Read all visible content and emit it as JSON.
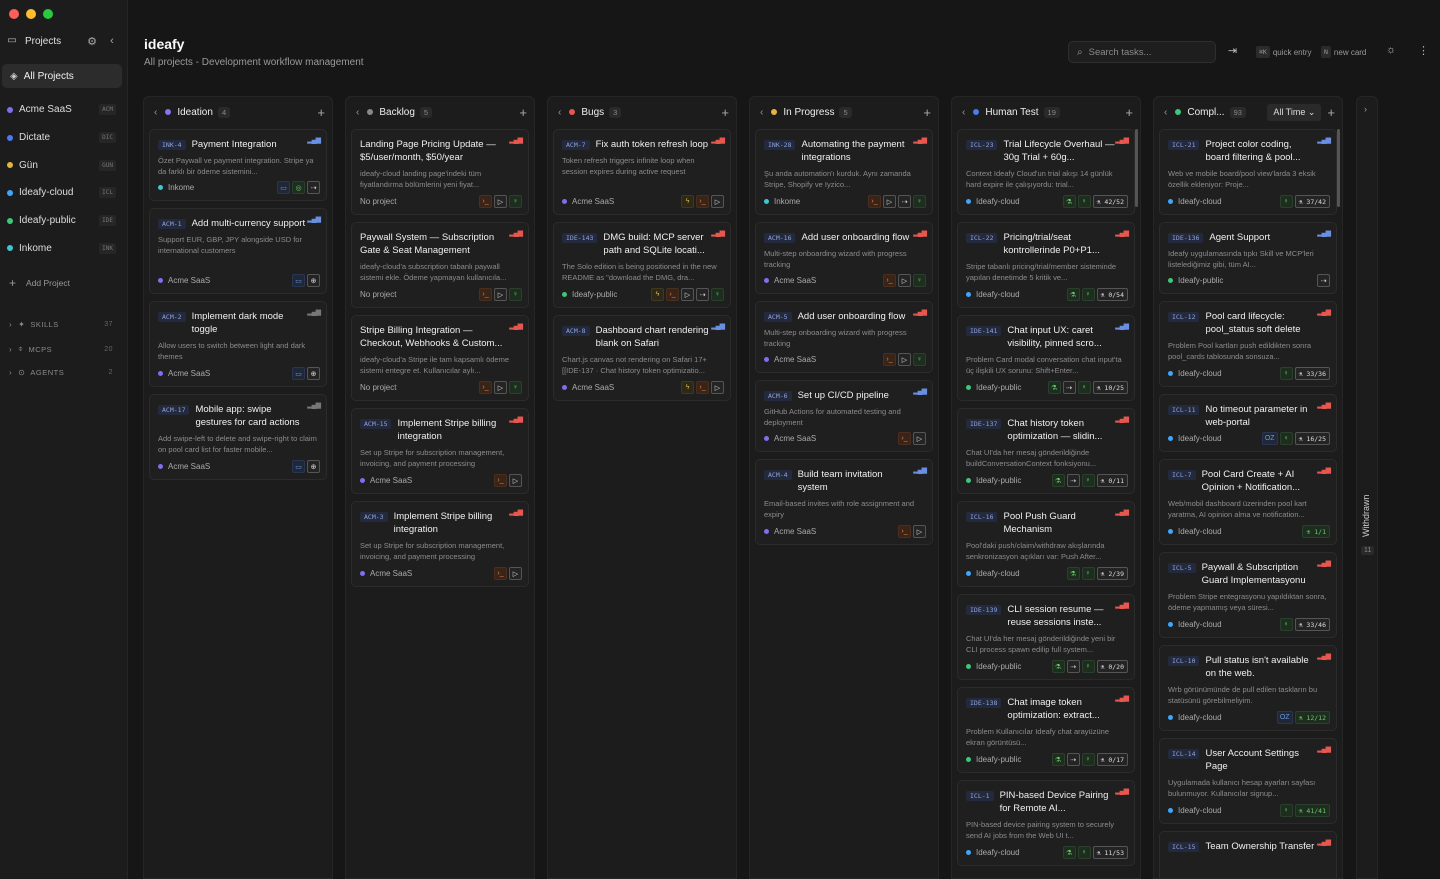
{
  "sidebar": {
    "heading": "Projects",
    "all_projects": "All Projects",
    "projects": [
      {
        "name": "Acme SaaS",
        "code": "ACM",
        "color": "#7c6ff0"
      },
      {
        "name": "Dictate",
        "code": "DIC",
        "color": "#4a7cf0"
      },
      {
        "name": "Gün",
        "code": "GUN",
        "color": "#e5b43c"
      },
      {
        "name": "Ideafy-cloud",
        "code": "ICL",
        "color": "#3ea6ff"
      },
      {
        "name": "Ideafy-public",
        "code": "IDE",
        "color": "#3cc878"
      },
      {
        "name": "Inkome",
        "code": "INK",
        "color": "#3ec7d0"
      }
    ],
    "add_project": "Add Project",
    "sections": [
      {
        "label": "SKILLS",
        "count": "37"
      },
      {
        "label": "MCPS",
        "count": "20"
      },
      {
        "label": "AGENTS",
        "count": "2"
      }
    ]
  },
  "header": {
    "title": "ideafy",
    "subtitle": "All projects - Development workflow management",
    "search_placeholder": "Search tasks...",
    "quick_entry_key": "⌘K",
    "quick_entry_label": "quick entry",
    "new_card_key": "N",
    "new_card_label": "new card"
  },
  "columns": [
    {
      "title": "Ideation",
      "count": "4",
      "color": "#8b6ff0",
      "cards": [
        {
          "code": "INK-4",
          "title": "Payment Integration",
          "desc": "Özet Paywall ve payment integration. Stripe ya da farklı bir ödeme sistemini...",
          "project": "Inkome",
          "pcolor": "#3ec7d0",
          "pri": "med",
          "acts": [
            [
              "b",
              "▭"
            ],
            [
              "g",
              "◎"
            ],
            [
              "n",
              "⇢"
            ]
          ],
          "h": 72
        },
        {
          "code": "ACM-1",
          "title": "Add multi-currency support",
          "desc": "Support EUR, GBP, JPY alongside USD for international customers",
          "project": "Acme SaaS",
          "pcolor": "#7c6ff0",
          "pri": "med",
          "acts": [
            [
              "b",
              "▭"
            ],
            [
              "n",
              "⊕"
            ]
          ],
          "h": 86
        },
        {
          "code": "ACM-2",
          "title": "Implement dark mode toggle",
          "desc": "Allow users to switch between light and dark themes",
          "project": "Acme SaaS",
          "pcolor": "#7c6ff0",
          "pri": "low",
          "acts": [
            [
              "b",
              "▭"
            ],
            [
              "n",
              "⊕"
            ]
          ],
          "h": 86
        },
        {
          "code": "ACM-17",
          "title": "Mobile app: swipe gestures for card actions",
          "desc": "Add swipe-left to delete and swipe-right to claim on pool card list for faster mobile...",
          "project": "Acme SaaS",
          "pcolor": "#7c6ff0",
          "pri": "low",
          "acts": [
            [
              "b",
              "▭"
            ],
            [
              "n",
              "⊕"
            ]
          ],
          "h": 86
        }
      ]
    },
    {
      "title": "Backlog",
      "count": "5",
      "color": "#888888",
      "cards": [
        {
          "code": "",
          "title": "Landing Page Pricing Update — $5/user/month, $50/year",
          "desc": "ideafy-cloud landing page'indeki tüm fiyatlandırma bölümlerini yeni fiyat...",
          "project": "No project",
          "pcolor": "",
          "pri": "high",
          "acts": [
            [
              "o",
              "›_"
            ],
            [
              "n",
              "▷"
            ],
            [
              "g",
              "♀"
            ]
          ],
          "h": 86
        },
        {
          "code": "",
          "title": "Paywall System — Subscription Gate & Seat Management",
          "desc": "ideafy-cloud'a subscription tabanlı paywall sistemi ekle. Ödeme yapmayan kullanıcıla...",
          "project": "No project",
          "pcolor": "",
          "pri": "high",
          "acts": [
            [
              "o",
              "›_"
            ],
            [
              "n",
              "▷"
            ],
            [
              "g",
              "♀"
            ]
          ],
          "h": 86
        },
        {
          "code": "",
          "title": "Stripe Billing Integration — Checkout, Webhooks & Custom...",
          "desc": "ideafy-cloud'a Stripe ile tam kapsamlı ödeme sistemi entegre et. Kullanıcılar aylı...",
          "project": "No project",
          "pcolor": "",
          "pri": "high",
          "acts": [
            [
              "o",
              "›_"
            ],
            [
              "n",
              "▷"
            ],
            [
              "g",
              "♀"
            ]
          ],
          "h": 86
        },
        {
          "code": "ACM-15",
          "title": "Implement Stripe billing integration",
          "desc": "Set up Stripe for subscription management, invoicing, and payment processing",
          "project": "Acme SaaS",
          "pcolor": "#7c6ff0",
          "pri": "high",
          "acts": [
            [
              "o",
              "›_"
            ],
            [
              "n",
              "▷"
            ]
          ],
          "h": 86
        },
        {
          "code": "ACM-3",
          "title": "Implement Stripe billing integration",
          "desc": "Set up Stripe for subscription management, invoicing, and payment processing",
          "project": "Acme SaaS",
          "pcolor": "#7c6ff0",
          "pri": "high",
          "acts": [
            [
              "o",
              "›_"
            ],
            [
              "n",
              "▷"
            ]
          ],
          "h": 86
        }
      ]
    },
    {
      "title": "Bugs",
      "count": "3",
      "color": "#e5574f",
      "cards": [
        {
          "code": "ACM-7",
          "title": "Fix auth token refresh loop",
          "desc": "Token refresh triggers infinite loop when session expires during active request",
          "project": "Acme SaaS",
          "pcolor": "#7c6ff0",
          "pri": "high",
          "acts": [
            [
              "y",
              "ϟ"
            ],
            [
              "o",
              "›_"
            ],
            [
              "n",
              "▷"
            ]
          ],
          "h": 86
        },
        {
          "code": "IDE-143",
          "title": "DMG build: MCP server path and SQLite locati...",
          "desc": "The Solo edition is being positioned in the new README as \"download the DMG, dra...",
          "project": "Ideafy-public",
          "pcolor": "#3cc878",
          "pri": "high",
          "acts": [
            [
              "y",
              "ϟ"
            ],
            [
              "o",
              "›_"
            ],
            [
              "n",
              "▷"
            ],
            [
              "n",
              "⇢"
            ],
            [
              "g",
              "♀"
            ]
          ],
          "h": 86
        },
        {
          "code": "ACM-8",
          "title": "Dashboard chart rendering blank on Safari",
          "desc": "Chart.js canvas not rendering on Safari 17+ [[IDE-137 · Chat history token optimizatio...",
          "project": "Acme SaaS",
          "pcolor": "#7c6ff0",
          "pri": "med",
          "acts": [
            [
              "y",
              "ϟ"
            ],
            [
              "o",
              "›_"
            ],
            [
              "n",
              "▷"
            ]
          ],
          "h": 86
        }
      ]
    },
    {
      "title": "In Progress",
      "count": "5",
      "color": "#e5b43c",
      "cards": [
        {
          "code": "INK-28",
          "title": "Automating the payment integrations",
          "desc": "Şu anda automation'ı kurduk. Aynı zamanda Stripe, Shopify ve Iyzico...",
          "project": "Inkome",
          "pcolor": "#3ec7d0",
          "pri": "high",
          "acts": [
            [
              "o",
              "›_"
            ],
            [
              "n",
              "▷"
            ],
            [
              "n",
              "⇢"
            ],
            [
              "g",
              "♀"
            ]
          ],
          "h": 86
        },
        {
          "code": "ACM-16",
          "title": "Add user onboarding flow",
          "desc": "Multi-step onboarding wizard with progress tracking",
          "project": "Acme SaaS",
          "pcolor": "#7c6ff0",
          "pri": "high",
          "acts": [
            [
              "o",
              "›_"
            ],
            [
              "n",
              "▷"
            ],
            [
              "g",
              "♀"
            ]
          ],
          "h": 72
        },
        {
          "code": "ACM-5",
          "title": "Add user onboarding flow",
          "desc": "Multi-step onboarding wizard with progress tracking",
          "project": "Acme SaaS",
          "pcolor": "#7c6ff0",
          "pri": "high",
          "acts": [
            [
              "o",
              "›_"
            ],
            [
              "n",
              "▷"
            ],
            [
              "g",
              "♀"
            ]
          ],
          "h": 72
        },
        {
          "code": "ACM-6",
          "title": "Set up CI/CD pipeline",
          "desc": "GitHub Actions for automated testing and deployment",
          "project": "Acme SaaS",
          "pcolor": "#7c6ff0",
          "pri": "med",
          "acts": [
            [
              "o",
              "›_"
            ],
            [
              "n",
              "▷"
            ]
          ],
          "h": 72
        },
        {
          "code": "ACM-4",
          "title": "Build team invitation system",
          "desc": "Email-based invites with role assignment and expiry",
          "project": "Acme SaaS",
          "pcolor": "#7c6ff0",
          "pri": "med",
          "acts": [
            [
              "o",
              "›_"
            ],
            [
              "n",
              "▷"
            ]
          ],
          "h": 86
        }
      ]
    },
    {
      "title": "Human Test",
      "count": "19",
      "color": "#4a7cf0",
      "cards": [
        {
          "code": "ICL-23",
          "title": "Trial Lifecycle Overhaul — 30g Trial + 60g...",
          "desc": "Context Ideafy Cloud'un trial akışı 14 günlük hard expire ile çalışıyordu: trial...",
          "project": "Ideafy-cloud",
          "pcolor": "#3ea6ff",
          "pri": "high",
          "acts": [
            [
              "g",
              "⚗"
            ],
            [
              "g",
              "♀"
            ],
            [
              "n",
              "⚗ 42/52"
            ]
          ],
          "h": 86
        },
        {
          "code": "ICL-22",
          "title": "Pricing/trial/seat kontrollerinde P0+P1...",
          "desc": "Stripe tabanlı pricing/trial/member sisteminde yapılan denetimde 5 kritik ve...",
          "project": "Ideafy-cloud",
          "pcolor": "#3ea6ff",
          "pri": "high",
          "acts": [
            [
              "g",
              "⚗"
            ],
            [
              "g",
              "♀"
            ],
            [
              "n",
              "⚗ 0/54"
            ]
          ],
          "h": 86
        },
        {
          "code": "IDE-141",
          "title": "Chat input UX: caret visibility, pinned scro...",
          "desc": "Problem Card modal conversation chat input'ta üç ilişkili UX sorunu: Shift+Enter...",
          "project": "Ideafy-public",
          "pcolor": "#3cc878",
          "pri": "med",
          "acts": [
            [
              "g",
              "⚗"
            ],
            [
              "n",
              "⇢"
            ],
            [
              "g",
              "♀"
            ],
            [
              "n",
              "⚗ 10/25"
            ]
          ],
          "h": 86
        },
        {
          "code": "IDE-137",
          "title": "Chat history token optimization — slidin...",
          "desc": "Chat UI'da her mesaj gönderildiğinde buildConversationContext fonksiyonu...",
          "project": "Ideafy-public",
          "pcolor": "#3cc878",
          "pri": "high",
          "acts": [
            [
              "g",
              "⚗"
            ],
            [
              "n",
              "⇢"
            ],
            [
              "g",
              "♀"
            ],
            [
              "n",
              "⚗ 0/11"
            ]
          ],
          "h": 86
        },
        {
          "code": "ICL-16",
          "title": "Pool Push Guard Mechanism",
          "desc": "Pool'daki push/claim/withdraw akışlarında senkronizasyon açıkları var: Push After...",
          "project": "Ideafy-cloud",
          "pcolor": "#3ea6ff",
          "pri": "high",
          "acts": [
            [
              "g",
              "⚗"
            ],
            [
              "g",
              "♀"
            ],
            [
              "n",
              "⚗ 2/39"
            ]
          ],
          "h": 86
        },
        {
          "code": "IDE-139",
          "title": "CLI session resume — reuse sessions inste...",
          "desc": "Chat UI'da her mesaj gönderildiğinde yeni bir CLI process spawn edilip full system...",
          "project": "Ideafy-public",
          "pcolor": "#3cc878",
          "pri": "high",
          "acts": [
            [
              "g",
              "⚗"
            ],
            [
              "n",
              "⇢"
            ],
            [
              "g",
              "♀"
            ],
            [
              "n",
              "⚗ 0/20"
            ]
          ],
          "h": 86
        },
        {
          "code": "IDE-138",
          "title": "Chat image token optimization: extract...",
          "desc": "Problem Kullanıcılar Ideafy chat arayüzüne ekran görüntüsü...",
          "project": "Ideafy-public",
          "pcolor": "#3cc878",
          "pri": "high",
          "acts": [
            [
              "g",
              "⚗"
            ],
            [
              "n",
              "⇢"
            ],
            [
              "g",
              "♀"
            ],
            [
              "n",
              "⚗ 0/17"
            ]
          ],
          "h": 86
        },
        {
          "code": "ICL-1",
          "title": "PIN-based Device Pairing for Remote AI...",
          "desc": "PIN-based device pairing system to securely send AI jobs from the Web UI t...",
          "project": "Ideafy-cloud",
          "pcolor": "#3ea6ff",
          "pri": "high",
          "acts": [
            [
              "g",
              "⚗"
            ],
            [
              "g",
              "♀"
            ],
            [
              "n",
              "⚗ 11/53"
            ]
          ],
          "h": 86
        }
      ]
    },
    {
      "title": "Compl...",
      "count": "93",
      "color": "#3cc878",
      "filter": "All Time",
      "cards": [
        {
          "code": "ICL-21",
          "title": "Project color coding, board filtering & pool...",
          "desc": "Web ve mobile board/pool view'larda 3 eksik özellik ekleniyor: Proje...",
          "project": "Ideafy-cloud",
          "pcolor": "#3ea6ff",
          "pri": "med",
          "acts": [
            [
              "g",
              "♀"
            ],
            [
              "n",
              "⚗ 37/42"
            ]
          ],
          "h": 86
        },
        {
          "code": "IDE-136",
          "title": "Agent Support",
          "desc": "Ideafy uygulamasında tıpkı Skill ve MCP'leri listelediğimiz gibi, tüm AI...",
          "project": "Ideafy-public",
          "pcolor": "#3cc878",
          "pri": "med",
          "acts": [
            [
              "n",
              "⇢"
            ]
          ],
          "h": 72
        },
        {
          "code": "ICL-12",
          "title": "Pool card lifecycle: pool_status soft delete",
          "desc": "Problem Pool kartları push edildikten sonra pool_cards tablosunda sonsuza...",
          "project": "Ideafy-cloud",
          "pcolor": "#3ea6ff",
          "pri": "high",
          "acts": [
            [
              "g",
              "♀"
            ],
            [
              "n",
              "⚗ 33/36"
            ]
          ],
          "h": 86
        },
        {
          "code": "ICL-11",
          "title": "No timeout parameter in web-portal",
          "desc": "",
          "project": "Ideafy-cloud",
          "pcolor": "#3ea6ff",
          "pri": "high",
          "acts": [
            [
              "b",
              "OZ"
            ],
            [
              "g",
              "♀"
            ],
            [
              "n",
              "⚗ 16/25"
            ]
          ],
          "h": 58
        },
        {
          "code": "ICL-7",
          "title": "Pool Card Create + AI Opinion + Notification...",
          "desc": "Web/mobil dashboard üzerinden pool kart yaratma, AI opinion alma ve notification...",
          "project": "Ideafy-cloud",
          "pcolor": "#3ea6ff",
          "pri": "high",
          "acts": [
            [
              "g",
              "⚗ 1/1"
            ]
          ],
          "h": 86
        },
        {
          "code": "ICL-5",
          "title": "Paywall & Subscription Guard Implementasyonu",
          "desc": "Problem Stripe entegrasyonu yapıldıktan sonra, ödeme yapmamış veya süresi...",
          "project": "Ideafy-cloud",
          "pcolor": "#3ea6ff",
          "pri": "high",
          "acts": [
            [
              "g",
              "♀"
            ],
            [
              "n",
              "⚗ 33/46"
            ]
          ],
          "h": 86
        },
        {
          "code": "ICL-10",
          "title": "Pull status isn't available on the web.",
          "desc": "Wrb görünümünde de pull edilen taskların bu statüsünü görebilmeliyim.",
          "project": "Ideafy-cloud",
          "pcolor": "#3ea6ff",
          "pri": "high",
          "acts": [
            [
              "b",
              "OZ"
            ],
            [
              "g",
              "⚗ 12/12"
            ]
          ],
          "h": 86
        },
        {
          "code": "ICL-14",
          "title": "User Account Settings Page",
          "desc": "Uygulamada kullanıcı hesap ayarları sayfası bulunmuyor. Kullanıcılar signup...",
          "project": "Ideafy-cloud",
          "pcolor": "#3ea6ff",
          "pri": "high",
          "acts": [
            [
              "g",
              "♀"
            ],
            [
              "g",
              "⚗ 41/41"
            ]
          ],
          "h": 86
        },
        {
          "code": "ICL-15",
          "title": "Team Ownership Transfer",
          "desc": "",
          "project": "",
          "pcolor": "",
          "pri": "high",
          "acts": [],
          "h": 86
        }
      ]
    }
  ],
  "withdrawn": {
    "label": "Withdrawn",
    "count": "11"
  }
}
